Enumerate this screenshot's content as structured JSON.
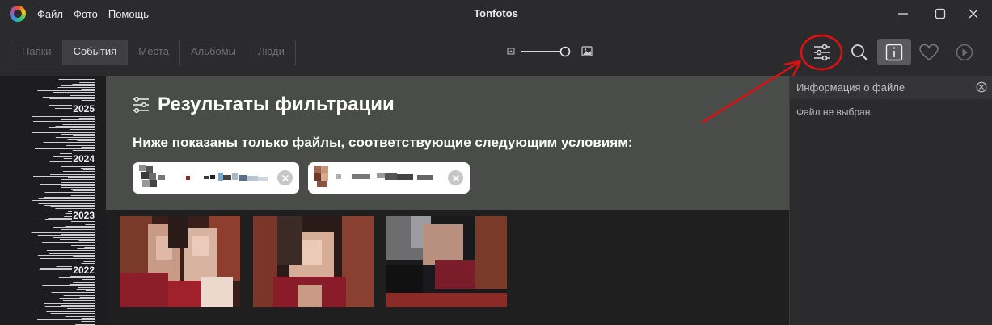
{
  "window": {
    "title": "Tonfotos"
  },
  "menu": [
    "Файл",
    "Фото",
    "Помощь"
  ],
  "tabs": [
    {
      "label": "Папки",
      "active": false
    },
    {
      "label": "События",
      "active": true
    },
    {
      "label": "Места",
      "active": false
    },
    {
      "label": "Альбомы",
      "active": false
    },
    {
      "label": "Люди",
      "active": false
    }
  ],
  "toolbar": {
    "zoom_level": 0.9,
    "buttons": [
      "filter-icon",
      "search-icon",
      "info-icon",
      "heart-icon",
      "play-icon"
    ]
  },
  "timeline": {
    "years": [
      "2025",
      "2024",
      "2023",
      "2022"
    ]
  },
  "filter": {
    "title": "Результаты фильтрации",
    "subtitle": "Ниже показаны только файлы, соответствующие следующим условиям:"
  },
  "info_panel": {
    "title": "Информация о файле",
    "empty_text": "Файл не выбран."
  },
  "colors": {
    "annotation": "#e01010",
    "accent": "#ffffff"
  }
}
